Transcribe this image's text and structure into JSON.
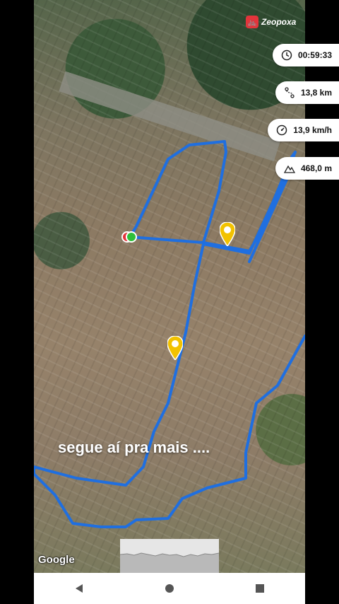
{
  "app": {
    "name": "Zeopoxa",
    "icon": "bike-icon",
    "accent": "#e3343b"
  },
  "stats": [
    {
      "name": "duration",
      "icon": "clock-icon",
      "value": "00:59:33"
    },
    {
      "name": "distance",
      "icon": "route-icon",
      "value": "13,8 km"
    },
    {
      "name": "speed",
      "icon": "speedometer-icon",
      "value": "13,9 km/h"
    },
    {
      "name": "elevation",
      "icon": "mountain-icon",
      "value": "468,0 m"
    }
  ],
  "caption": "segue aí pra mais ....",
  "map": {
    "attribution": "Google",
    "route_color": "#1f6fe0",
    "start_marker_color": "#2fbf3a",
    "end_marker_color": "#e3343b",
    "pin_color": "#f2c200"
  },
  "navbar": {
    "back": "back-icon",
    "home": "home-icon",
    "recents": "recents-icon"
  }
}
